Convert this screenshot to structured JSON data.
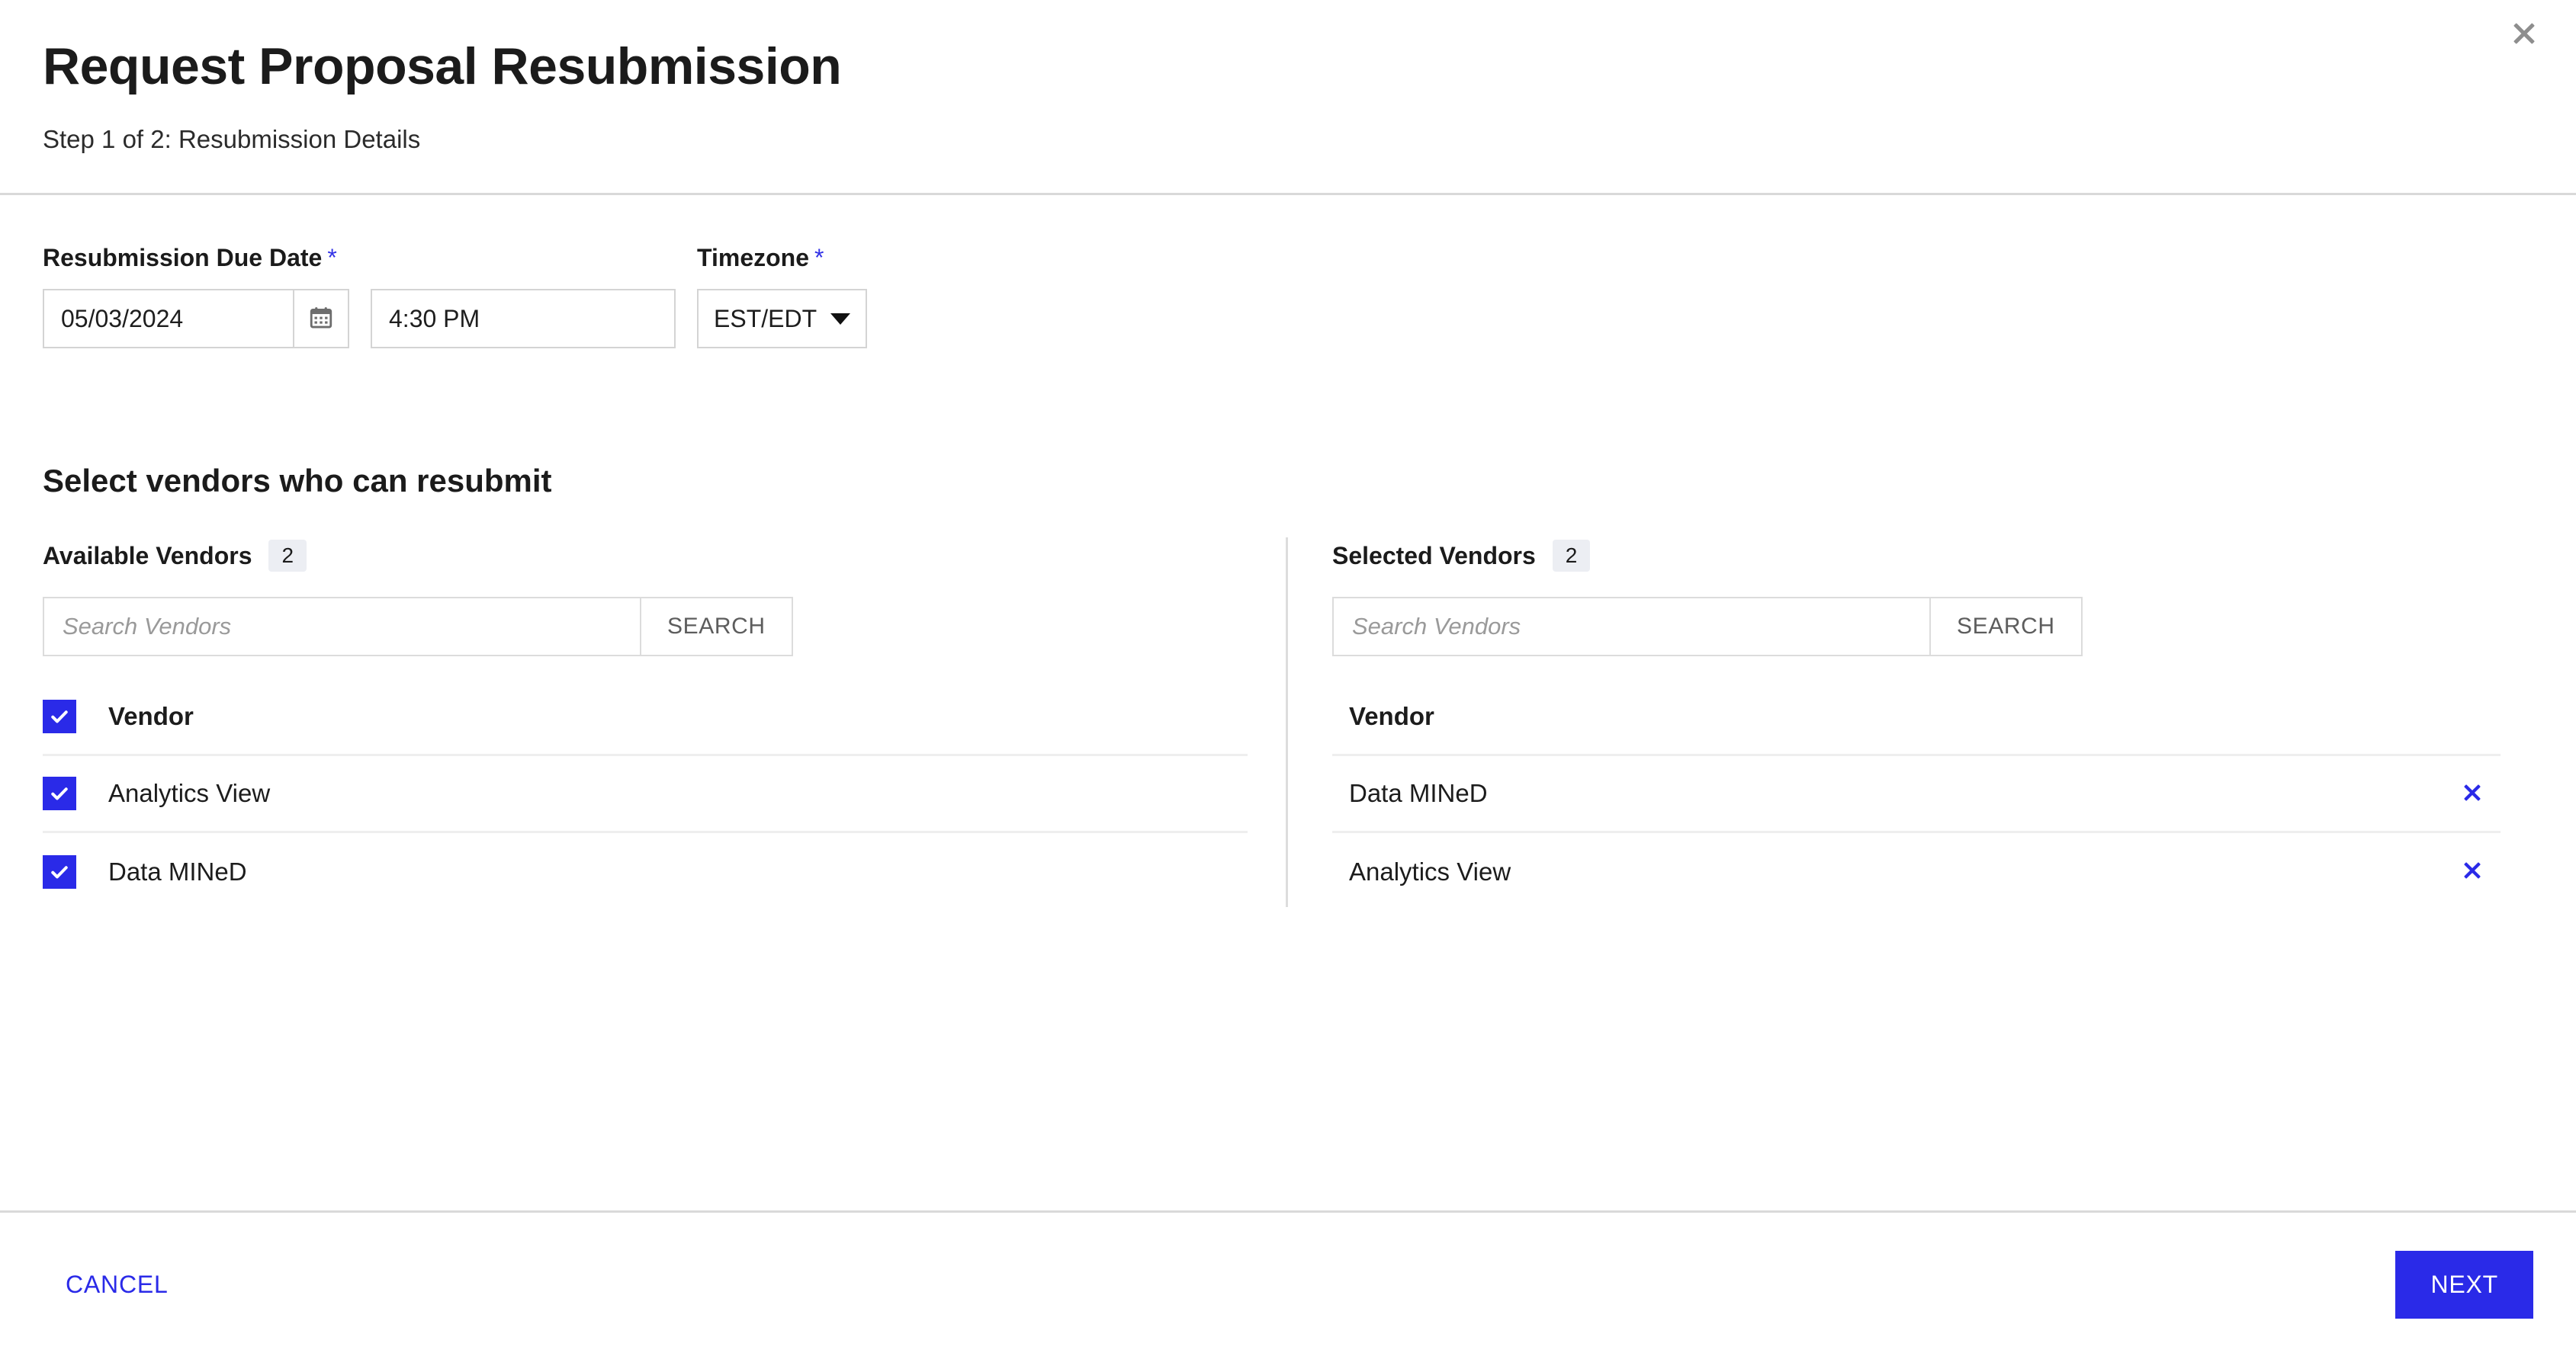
{
  "dialog": {
    "title": "Request Proposal Resubmission",
    "subtitle": "Step 1 of 2: Resubmission Details",
    "close_icon": "close-icon"
  },
  "accent_color": "#2a2ae8",
  "form": {
    "due_date": {
      "label": "Resubmission Due Date",
      "required_marker": "*",
      "date_value": "05/03/2024",
      "date_placeholder": "MM/DD/YYYY",
      "calendar_icon": "calendar-icon",
      "time_value": "4:30 PM",
      "time_placeholder": "hh:mm AM/PM"
    },
    "timezone": {
      "label": "Timezone",
      "required_marker": "*",
      "value": "EST/EDT",
      "caret_icon": "chevron-down-icon"
    }
  },
  "vendor_section": {
    "heading": "Select vendors who can resubmit",
    "available": {
      "title": "Available Vendors",
      "count": "2",
      "search_placeholder": "Search Vendors",
      "search_value": "",
      "search_button": "SEARCH",
      "column_header": "Vendor",
      "rows": [
        {
          "name": "Analytics View",
          "checked": true
        },
        {
          "name": "Data MINeD",
          "checked": true
        }
      ],
      "header_checked": true
    },
    "selected": {
      "title": "Selected Vendors",
      "count": "2",
      "search_placeholder": "Search Vendors",
      "search_value": "",
      "search_button": "SEARCH",
      "column_header": "Vendor",
      "rows": [
        {
          "name": "Data MINeD",
          "remove_icon": "close-icon"
        },
        {
          "name": "Analytics View",
          "remove_icon": "close-icon"
        }
      ]
    }
  },
  "footer": {
    "cancel_label": "CANCEL",
    "next_label": "NEXT"
  }
}
